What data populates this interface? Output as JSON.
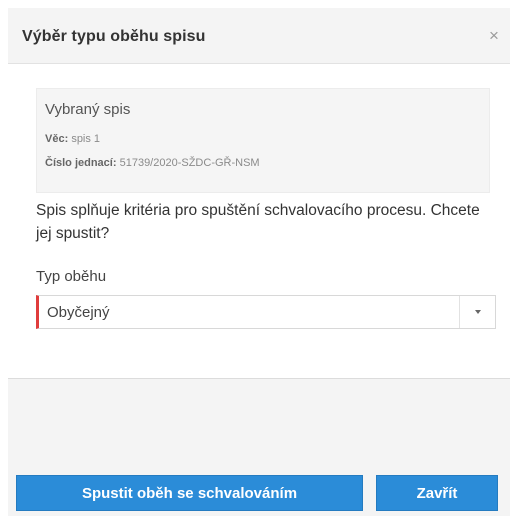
{
  "dialog": {
    "title": "Výběr typu oběhu spisu",
    "close_label": "×"
  },
  "selected": {
    "title": "Vybraný spis",
    "vec_label": "Věc:",
    "vec_value": "spis 1",
    "cislo_label": "Číslo jednací:",
    "cislo_value": "51739/2020-SŽDC-GŘ-NSM"
  },
  "message": "Spis splňuje kritéria pro spuštění schvalovacího procesu. Chcete jej spustit?",
  "field": {
    "label": "Typ oběhu",
    "selected_value": "Obyčejný"
  },
  "buttons": {
    "start_label": "Spustit oběh se schvalováním",
    "close_label": "Zavřít"
  },
  "colors": {
    "primary": "#2b8cd8",
    "required_marker": "#e03c3c"
  }
}
